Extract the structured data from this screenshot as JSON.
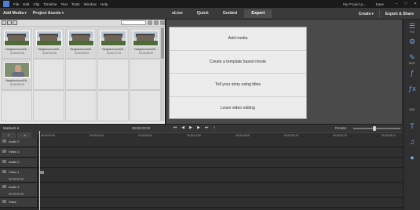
{
  "menu_bar": {
    "items": [
      "File",
      "Edit",
      "Clip",
      "Timeline",
      "Text",
      "Tools",
      "Window",
      "Help"
    ],
    "project_name": "My Project.p...",
    "save_label": "Save",
    "window_controls": [
      "minimize-icon",
      "maximize-icon",
      "close-icon"
    ]
  },
  "toolbar": {
    "add_media": "Add Media",
    "project_assets": "Project Assets",
    "modes": [
      "eLive",
      "Quick",
      "Guided",
      "Expert"
    ],
    "active_mode": "Expert",
    "create": "Create",
    "export_share": "Export & Share"
  },
  "assets": {
    "search_placeholder": "",
    "clips": [
      {
        "name": "Neighborhood26...",
        "duration": "00:00:09:26",
        "kind": "house"
      },
      {
        "name": "Neighborhood26...",
        "duration": "00:00:10:05",
        "kind": "house"
      },
      {
        "name": "Neighborhood26...",
        "duration": "00:00:09:03",
        "kind": "house"
      },
      {
        "name": "Neighborhood26...",
        "duration": "00:00:07:23",
        "kind": "house"
      },
      {
        "name": "Neighborhood26...",
        "duration": "00:00:08:22",
        "kind": "house"
      },
      {
        "name": "Neighborhood26...",
        "duration": "00:00:09:10",
        "kind": "person"
      }
    ]
  },
  "monitor": {
    "actions": [
      "Add media",
      "Create a template based movie",
      "Tell your story using titles",
      "Learn video editing"
    ]
  },
  "right_panel": {
    "items": [
      {
        "icon": "adjust-icon",
        "glyph": "☰",
        "label": "FIX"
      },
      {
        "icon": "adjust-sliders-icon",
        "glyph": "⚙",
        "label": ""
      },
      {
        "icon": "edit-icon",
        "glyph": "✎",
        "label": "EDIT"
      },
      {
        "icon": "effects-icon",
        "glyph": "ƒ",
        "label": ""
      },
      {
        "icon": "fx-icon",
        "glyph": "ƒx",
        "label": ""
      },
      {
        "icon": "add-icon",
        "glyph": "",
        "label": "ADD"
      },
      {
        "icon": "title-icon",
        "glyph": "T",
        "label": ""
      },
      {
        "icon": "music-icon",
        "glyph": "♫",
        "label": ""
      },
      {
        "icon": "graphics-icon",
        "glyph": "●",
        "label": ""
      }
    ]
  },
  "timeline": {
    "mode": "Markers",
    "current_time": "00;00;00;00",
    "render_label": "Render",
    "ruler": [
      "00;00;00;00",
      "00;00;04;02",
      "00;00;08;04",
      "00;00;12;06",
      "00;00;16;08",
      "00;00;20;10",
      "00;00;24;12",
      "00;00;28;14"
    ],
    "tracks": [
      {
        "name": "Audio 2",
        "height": "short"
      },
      {
        "name": "Video 2",
        "height": "short"
      },
      {
        "name": "Audio 2",
        "height": "short"
      },
      {
        "name": "Video 1",
        "height": "tall"
      },
      {
        "name": "Audio 1",
        "height": "tall"
      },
      {
        "name": "Voice",
        "height": "short"
      }
    ]
  }
}
